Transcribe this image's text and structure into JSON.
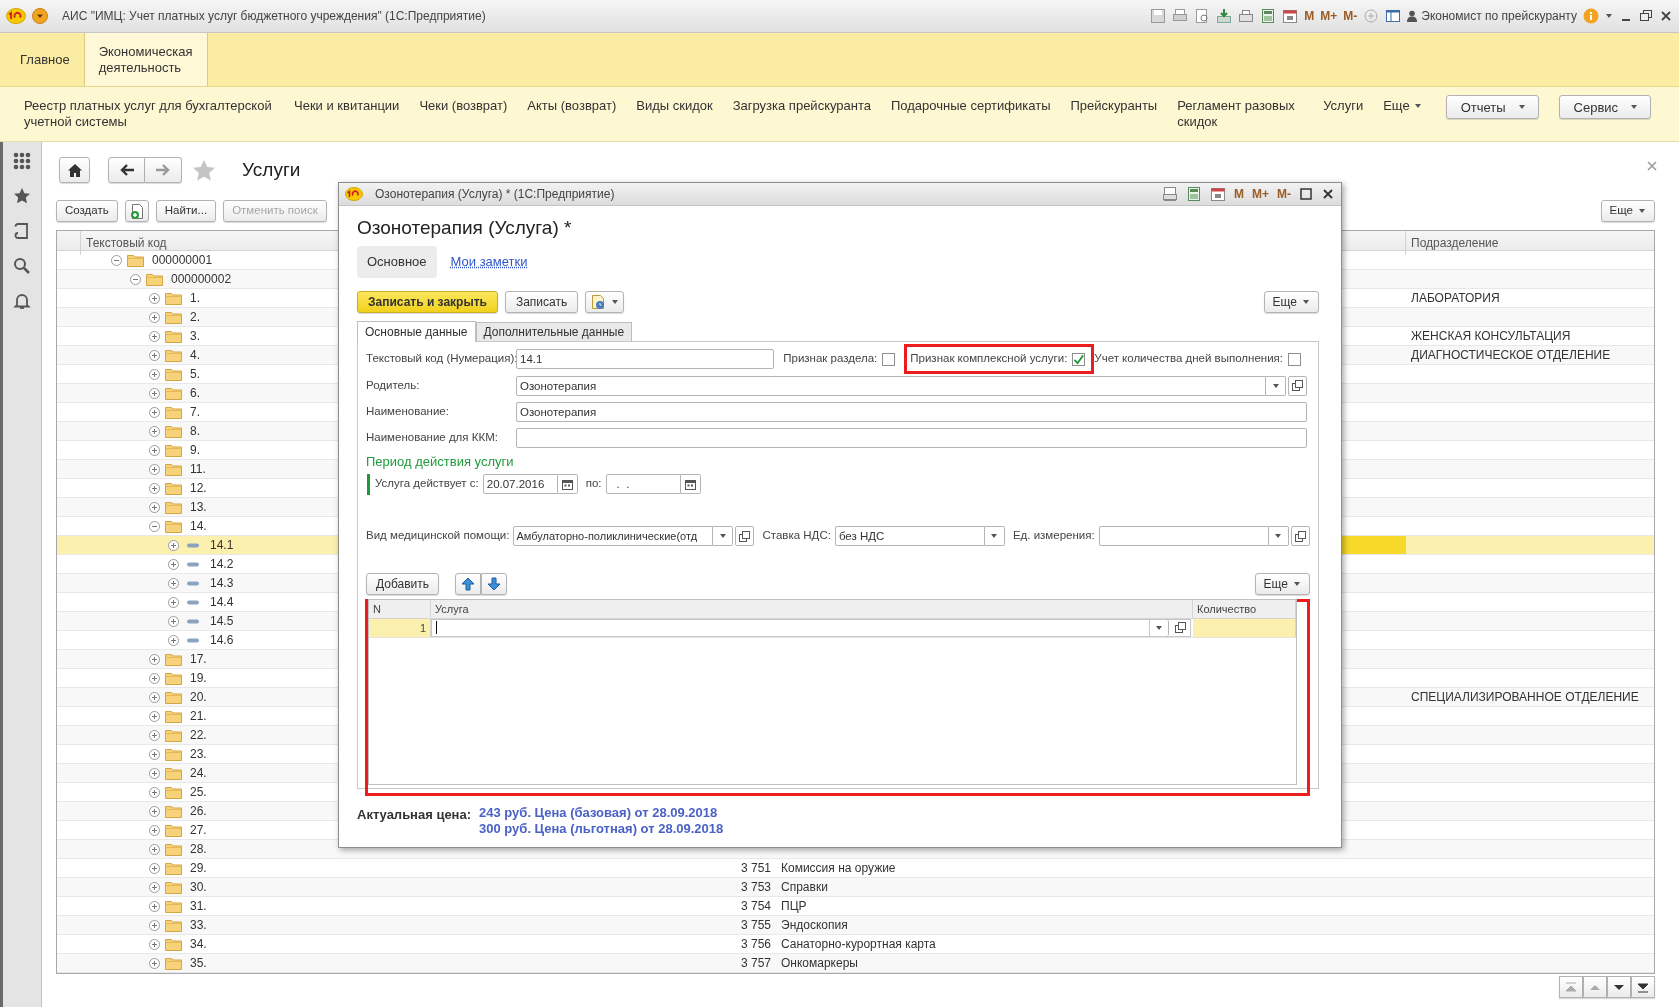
{
  "app": {
    "title": "АИС \"ИМЦ: Учет платных услуг бюджетного учреждения\"",
    "platform": "(1С:Предприятие)",
    "memory_keys": [
      "M",
      "M+",
      "M-"
    ],
    "user": "Экономист по прейскуранту"
  },
  "sections": [
    {
      "label": "Главное",
      "selected": false
    },
    {
      "label": "Экономическая деятельность",
      "selected": true
    }
  ],
  "commands": [
    {
      "label": "Реестр платных услуг для бухгалтерской учетной системы",
      "kind": "link"
    },
    {
      "label": "Чеки и квитанции",
      "kind": "link"
    },
    {
      "label": "Чеки (возврат)",
      "kind": "link"
    },
    {
      "label": "Акты (возврат)",
      "kind": "link"
    },
    {
      "label": "Виды скидок",
      "kind": "link"
    },
    {
      "label": "Загрузка прейскуранта",
      "kind": "link"
    },
    {
      "label": "Подарочные сертификаты",
      "kind": "link"
    },
    {
      "label": "Прейскуранты",
      "kind": "link"
    },
    {
      "label": "Регламент разовых скидок",
      "kind": "link"
    },
    {
      "label": "Услуги",
      "kind": "link"
    },
    {
      "label": "Еще",
      "kind": "menu"
    },
    {
      "label": "Отчеты",
      "kind": "button"
    },
    {
      "label": "Сервис",
      "kind": "button"
    }
  ],
  "list": {
    "title": "Услуги",
    "toolbar": [
      {
        "label": "Создать",
        "kind": "button",
        "disabled": false
      },
      {
        "kind": "icon",
        "disabled": false
      },
      {
        "label": "Найти...",
        "kind": "button",
        "disabled": false
      },
      {
        "label": "Отменить поиск",
        "kind": "button",
        "disabled": true
      }
    ],
    "more": "Еще",
    "columns": {
      "code": "Текстовый код",
      "subdivision": "Подразделение"
    },
    "rows": [
      {
        "code": "000000001",
        "kind": "group",
        "expanded": true,
        "selected": false,
        "children": [
          {
            "code": "000000002",
            "kind": "group",
            "expanded": true,
            "selected": false,
            "children": [
              {
                "code": "1.",
                "kind": "group",
                "expanded": false,
                "selected": false,
                "subdivision": "ЛАБОРАТОРИЯ"
              },
              {
                "code": "2.",
                "kind": "group",
                "expanded": false,
                "selected": false
              },
              {
                "code": "3.",
                "kind": "group",
                "expanded": false,
                "selected": false,
                "subdivision": "ЖЕНСКАЯ КОНСУЛЬТАЦИЯ"
              },
              {
                "code": "4.",
                "kind": "group",
                "expanded": false,
                "selected": false,
                "subdivision": "ДИАГНОСТИЧЕСКОЕ ОТДЕЛЕНИЕ"
              },
              {
                "code": "5.",
                "kind": "group",
                "expanded": false,
                "selected": false
              },
              {
                "code": "6.",
                "kind": "group",
                "expanded": false,
                "selected": false
              },
              {
                "code": "7.",
                "kind": "group",
                "expanded": false,
                "selected": false
              },
              {
                "code": "8.",
                "kind": "group",
                "expanded": false,
                "selected": false
              },
              {
                "code": "9.",
                "kind": "group",
                "expanded": false,
                "selected": false
              },
              {
                "code": "11.",
                "kind": "group",
                "expanded": false,
                "selected": false
              },
              {
                "code": "12.",
                "kind": "group",
                "expanded": false,
                "selected": false
              },
              {
                "code": "13.",
                "kind": "group",
                "expanded": false,
                "selected": false
              },
              {
                "code": "14.",
                "kind": "group",
                "expanded": true,
                "selected": false,
                "children": [
                  {
                    "code": "14.1",
                    "kind": "item",
                    "expanded": false,
                    "selected": true
                  },
                  {
                    "code": "14.2",
                    "kind": "item",
                    "expanded": false,
                    "selected": false
                  },
                  {
                    "code": "14.3",
                    "kind": "item",
                    "expanded": false,
                    "selected": false
                  },
                  {
                    "code": "14.4",
                    "kind": "item",
                    "expanded": false,
                    "selected": false
                  },
                  {
                    "code": "14.5",
                    "kind": "item",
                    "expanded": false,
                    "selected": false
                  },
                  {
                    "code": "14.6",
                    "kind": "item",
                    "expanded": false,
                    "selected": false
                  }
                ]
              },
              {
                "code": "17.",
                "kind": "group",
                "expanded": false,
                "selected": false
              },
              {
                "code": "19.",
                "kind": "group",
                "expanded": false,
                "selected": false
              },
              {
                "code": "20.",
                "kind": "group",
                "expanded": false,
                "selected": false,
                "subdivision": "СПЕЦИАЛИЗИРОВАННОЕ ОТДЕЛЕНИЕ"
              },
              {
                "code": "21.",
                "kind": "group",
                "expanded": false,
                "selected": false
              },
              {
                "code": "22.",
                "kind": "group",
                "expanded": false,
                "selected": false
              },
              {
                "code": "23.",
                "kind": "group",
                "expanded": false,
                "selected": false
              },
              {
                "code": "24.",
                "kind": "group",
                "expanded": false,
                "selected": false
              },
              {
                "code": "25.",
                "kind": "group",
                "expanded": false,
                "selected": false
              },
              {
                "code": "26.",
                "kind": "group",
                "expanded": false,
                "selected": false
              },
              {
                "code": "27.",
                "kind": "group",
                "expanded": false,
                "selected": false
              },
              {
                "code": "28.",
                "kind": "group",
                "expanded": false,
                "selected": false
              },
              {
                "code": "29.",
                "kind": "group",
                "expanded": false,
                "selected": false,
                "column_2": "3 751",
                "column_3": "Комиссия на оружие"
              },
              {
                "code": "30.",
                "kind": "group",
                "expanded": false,
                "selected": false,
                "column_2": "3 753",
                "column_3": "Справки"
              },
              {
                "code": "31.",
                "kind": "group",
                "expanded": false,
                "selected": false,
                "column_2": "3 754",
                "column_3": "ПЦР"
              },
              {
                "code": "33.",
                "kind": "group",
                "expanded": false,
                "selected": false,
                "column_2": "3 755",
                "column_3": "Эндоскопия"
              },
              {
                "code": "34.",
                "kind": "group",
                "expanded": false,
                "selected": false,
                "column_2": "3 756",
                "column_3": "Санаторно-курортная карта"
              },
              {
                "code": "35.",
                "kind": "group",
                "expanded": false,
                "selected": false,
                "column_2": "3 757",
                "column_3": "Онкомаркеры"
              }
            ]
          }
        ]
      }
    ]
  },
  "dialog": {
    "title": "Озонотерапия (Услуга) *",
    "platform": "(1С:Предприятие)",
    "memory_keys": [
      "M",
      "M+",
      "M-"
    ],
    "heading": "Озонотерапия (Услуга) *",
    "nav": [
      {
        "label": "Основное",
        "selected": true
      },
      {
        "label": "Мои заметки",
        "selected": false
      }
    ],
    "commands": {
      "save_close": "Записать и закрыть",
      "save": "Записать",
      "more": "Еще"
    },
    "tabs": [
      {
        "label": "Основные данные",
        "selected": true
      },
      {
        "label": "Дополнительные данные",
        "selected": false
      }
    ],
    "code": {
      "label": "Текстовый код (Нумерация):",
      "value": "14.1"
    },
    "flags": [
      {
        "label": "Признак раздела:",
        "checked": false,
        "highlighted": false
      },
      {
        "label": "Признак комплексной услуги:",
        "checked": true,
        "highlighted": true
      },
      {
        "label": "Учет количества дней выполнения:",
        "checked": false,
        "highlighted": false
      }
    ],
    "parent": {
      "label": "Родитель:",
      "value": "Озонотерапия"
    },
    "name": {
      "label": "Наименование:",
      "value": "Озонотерапия"
    },
    "kkm_name": {
      "label": "Наименование для ККМ:"
    },
    "period": {
      "title": "Период действия услуги",
      "from_label": "Услуга действует с:",
      "from": "20.07.2016",
      "to_label": "по:",
      "to": ".  ."
    },
    "care_type": {
      "label": "Вид медицинской помощи:",
      "value": "Амбулаторно-поликлинические(отд"
    },
    "vat": {
      "label": "Ставка НДС:",
      "value": "без НДС"
    },
    "unit": {
      "label": "Ед. измерения:"
    },
    "table": {
      "add": "Добавить",
      "more": "Еще",
      "highlighted": true,
      "columns": [
        "N",
        "Услуга",
        "Количество"
      ],
      "rows": [
        {
          "n": "1",
          "selected": true,
          "editing": true
        }
      ]
    },
    "price": {
      "label": "Актуальная цена:",
      "lines": [
        "243 руб. Цена (базовая) от 28.09.2018",
        "300 руб. Цена (льготная) от 28.09.2018"
      ]
    }
  }
}
